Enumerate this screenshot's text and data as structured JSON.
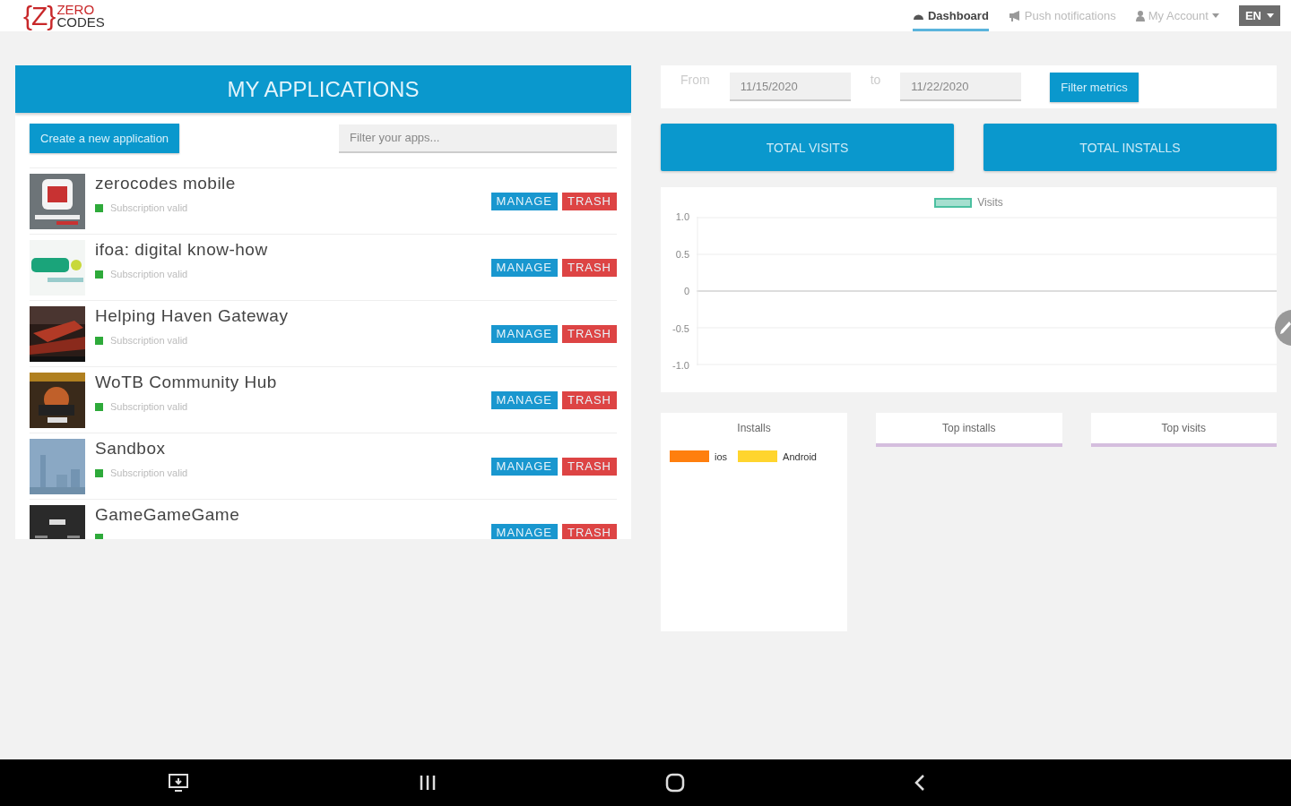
{
  "logo": {
    "mark": "{Z}",
    "line1": "ZERO",
    "line2": "CODES"
  },
  "nav": [
    {
      "label": "Dashboard",
      "selected": true,
      "caret": false
    },
    {
      "label": "Push notifications",
      "selected": false,
      "caret": false
    },
    {
      "label": "My Account",
      "selected": false,
      "caret": true
    }
  ],
  "language": "EN",
  "applications": {
    "title": "MY APPLICATIONS",
    "create_button": "Create a new application",
    "filter": {
      "placeholder": "Filter your apps..."
    },
    "items": [
      {
        "name": "zerocodes mobile",
        "valid": true,
        "status": "Subscription valid",
        "manage": "MANAGE",
        "trash": "TRASH"
      },
      {
        "name": "ifoa: digital know-how",
        "valid": true,
        "status": "Subscription valid",
        "manage": "MANAGE",
        "trash": "TRASH"
      },
      {
        "name": "Helping Haven Gateway",
        "valid": true,
        "status": "Subscription valid",
        "manage": "MANAGE",
        "trash": "TRASH"
      },
      {
        "name": "WoTB Community Hub",
        "valid": true,
        "status": "Subscription valid",
        "manage": "MANAGE",
        "trash": "TRASH"
      },
      {
        "name": "Sandbox",
        "valid": true,
        "status": "Subscription valid",
        "manage": "MANAGE",
        "trash": "TRASH"
      },
      {
        "name": "GameGameGame",
        "valid": true,
        "manage": "MANAGE",
        "trash": "TRASH"
      }
    ]
  },
  "filter": {
    "from_label": "From",
    "from_value": "11/15/2020",
    "to_label": "to",
    "to_value": "11/22/2020",
    "button": "Filter metrics"
  },
  "totals": [
    "TOTAL VISITS",
    "TOTAL INSTALLS"
  ],
  "visits_chart": {
    "chart_data": {
      "type": "line",
      "series": [
        {
          "name": "Visits",
          "color": "#4bc0a0"
        }
      ],
      "ylim": [
        -1,
        1
      ],
      "yticks": [
        {
          "value": 1,
          "label": "1.0"
        },
        {
          "value": 0.5,
          "label": "0.5"
        },
        {
          "value": 0,
          "label": "0"
        },
        {
          "value": -0.5,
          "label": "-0.5"
        },
        {
          "value": -1,
          "label": "-1.0"
        }
      ]
    }
  },
  "installs": {
    "title": "Installs",
    "legend": [
      {
        "label": "ios",
        "color": "#ff7f0e"
      },
      {
        "label": "Android",
        "color": "#ffd52e"
      }
    ]
  },
  "top_panels": [
    "Top installs",
    "Top visits"
  ]
}
